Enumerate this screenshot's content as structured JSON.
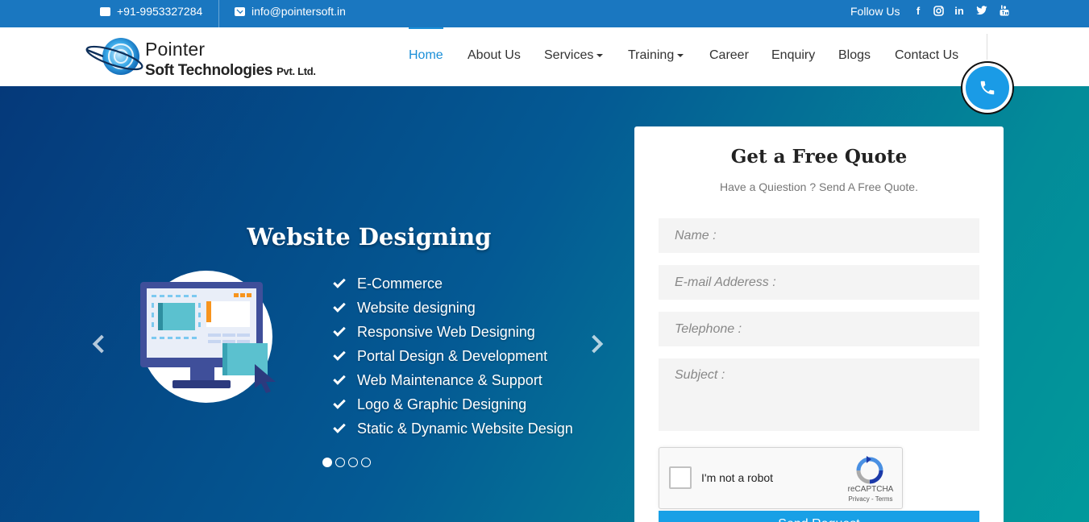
{
  "topbar": {
    "phone": "+91-9953327284",
    "email": "info@pointersoft.in",
    "follow_label": "Follow Us",
    "social": [
      "facebook-icon",
      "instagram-icon",
      "linkedin-icon",
      "twitter-icon",
      "youtube-icon"
    ]
  },
  "logo": {
    "line1": "Pointer",
    "line2": "Soft Technologies",
    "line2_suffix": "Pvt. Ltd."
  },
  "nav": {
    "items": [
      {
        "label": "Home",
        "active": true
      },
      {
        "label": "About Us"
      },
      {
        "label": "Services",
        "dropdown": true
      },
      {
        "label": "Training",
        "dropdown": true
      },
      {
        "label": "Career"
      },
      {
        "label": "Enquiry"
      },
      {
        "label": "Blogs"
      },
      {
        "label": "Contact Us"
      }
    ]
  },
  "hero": {
    "title": "Website Designing",
    "features": [
      "E-Commerce",
      "Website designing",
      "Responsive Web Designing",
      "Portal Design & Development",
      "Web Maintenance & Support",
      "Logo & Graphic Designing",
      "Static & Dynamic Website Design"
    ],
    "slides_total": 4,
    "slide_active": 1
  },
  "quote": {
    "title": "Get a Free Quote",
    "subtitle": "Have a Quiestion ? Send A Free Quote.",
    "name_placeholder": "Name :",
    "email_placeholder": "E-mail Adderess :",
    "phone_placeholder": "Telephone :",
    "subject_placeholder": "Subject :",
    "captcha_label": "I'm not a robot",
    "captcha_brand": "reCAPTCHA",
    "captcha_links": "Privacy - Terms",
    "submit_label": "Send Request"
  },
  "colors": {
    "topbar": "#1a77c0",
    "accent": "#1a8fd8",
    "submit": "#18a0e6"
  }
}
